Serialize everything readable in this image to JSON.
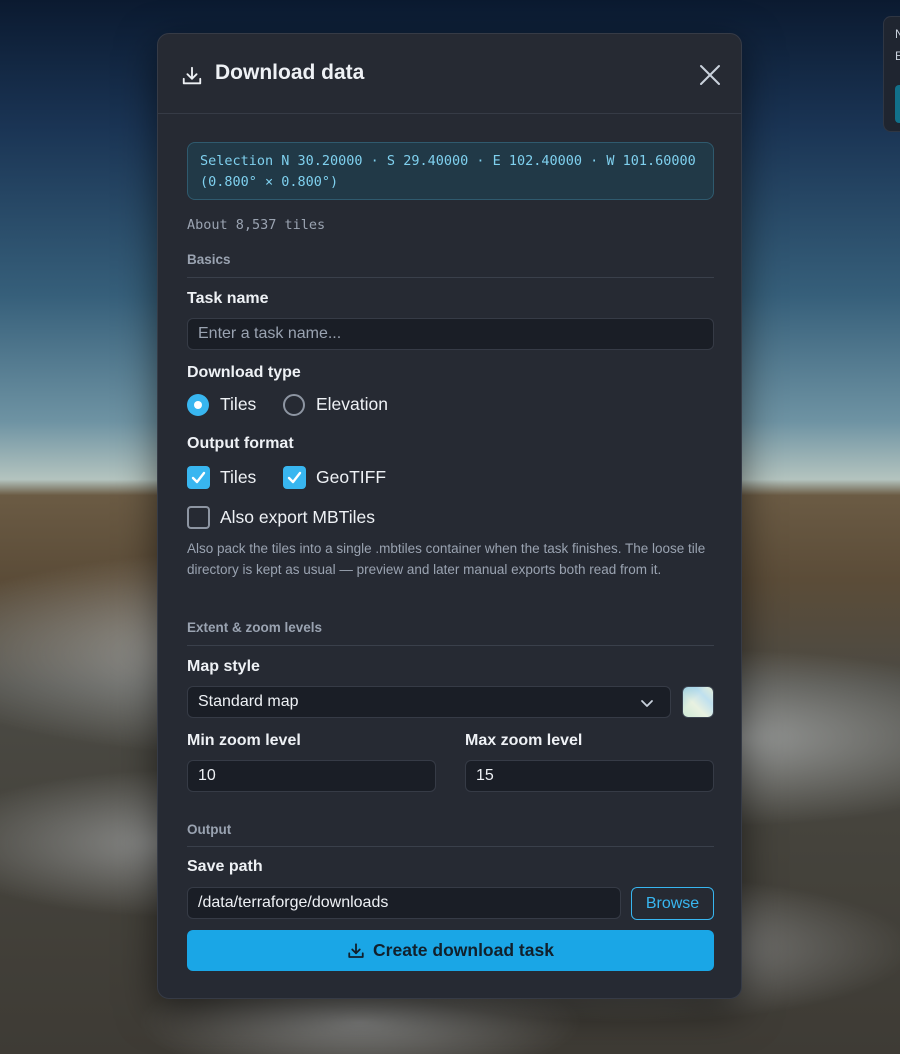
{
  "corner_widget": {
    "line1": "N",
    "line2": "E"
  },
  "dialog": {
    "title": "Download data",
    "selection_text": "Selection N 30.20000 · S 29.40000 · E 102.40000 · W 101.60000 (0.800° × 0.800°)",
    "tile_count": "About 8,537 tiles",
    "sections": {
      "basics": "Basics",
      "extent": "Extent & zoom levels",
      "output": "Output"
    },
    "task_name": {
      "label": "Task name",
      "value": "",
      "placeholder": "Enter a task name..."
    },
    "download_type": {
      "label": "Download type",
      "options": [
        {
          "label": "Tiles",
          "selected": true
        },
        {
          "label": "Elevation",
          "selected": false
        }
      ]
    },
    "output_format": {
      "label": "Output format",
      "options": [
        {
          "label": "Tiles",
          "checked": true
        },
        {
          "label": "GeoTIFF",
          "checked": true
        },
        {
          "label": "Also export MBTiles",
          "checked": false
        }
      ],
      "help": "Also pack the tiles into a single .mbtiles container when the task finishes. The loose tile directory is kept as usual — preview and later manual exports both read from it."
    },
    "map_style": {
      "label": "Map style",
      "value": "Standard map"
    },
    "min_zoom": {
      "label": "Min zoom level",
      "value": "10"
    },
    "max_zoom": {
      "label": "Max zoom level",
      "value": "15"
    },
    "save_path": {
      "label": "Save path",
      "value": "/data/terraforge/downloads",
      "browse_label": "Browse"
    },
    "create_label": "Create download task"
  },
  "colors": {
    "accent": "#38b6f0",
    "primary_button": "#1aa6e6",
    "panel_bg": "#262a33"
  }
}
